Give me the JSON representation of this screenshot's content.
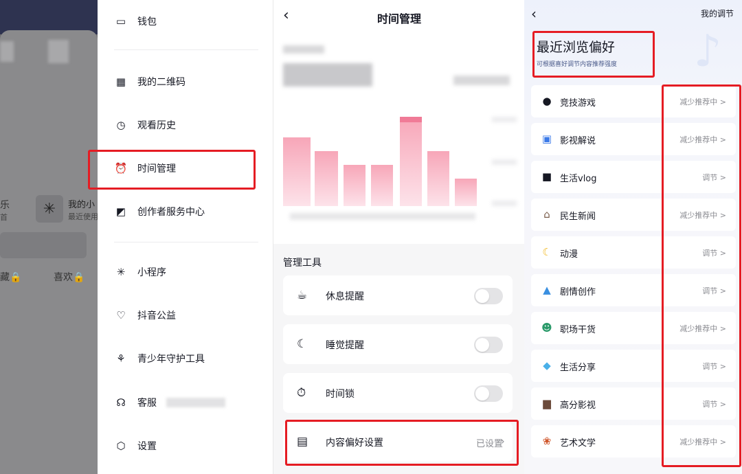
{
  "profile_panel": {
    "frag_le": "乐",
    "frag_ye": "首",
    "mine_label": "我的小",
    "recent_label": "最近使用",
    "fav_label": "藏🔒",
    "like_label": "喜欢🔒"
  },
  "menu": {
    "items": [
      {
        "label": "钱包",
        "icon": "wallet-icon"
      },
      {
        "label": "我的二维码",
        "icon": "qrcode-icon"
      },
      {
        "label": "观看历史",
        "icon": "clock-icon"
      },
      {
        "label": "时间管理",
        "icon": "alarm-icon"
      },
      {
        "label": "创作者服务中心",
        "icon": "chart-icon"
      },
      {
        "label": "小程序",
        "icon": "asterisk-icon"
      },
      {
        "label": "抖音公益",
        "icon": "heart-icon"
      },
      {
        "label": "青少年守护工具",
        "icon": "sprout-icon"
      },
      {
        "label": "客服",
        "icon": "headset-icon"
      },
      {
        "label": "设置",
        "icon": "hexagon-icon"
      }
    ]
  },
  "time_mgmt": {
    "title": "时间管理",
    "tools_header": "管理工具",
    "tools": [
      {
        "label": "休息提醒",
        "icon": "coffee-icon"
      },
      {
        "label": "睡觉提醒",
        "icon": "moon-icon"
      },
      {
        "label": "时间锁",
        "icon": "timer-lock-icon"
      }
    ],
    "pref_row": {
      "label": "内容偏好设置",
      "value": "已设置",
      "icon": "document-heart-icon"
    }
  },
  "usage_chart": {
    "colors": {
      "bar": "#f7a6b8",
      "bar_peak": "#f07b97"
    }
  },
  "adjust": {
    "title": "我的调节",
    "heading": "最近浏览偏好",
    "subheading": "可根据喜好调节内容推荐强度",
    "rows": [
      {
        "label": "竞技游戏",
        "status": "减少推荐中 >",
        "icon": "billiard-ball-icon"
      },
      {
        "label": "影视解说",
        "status": "减少推荐中 >",
        "icon": "tv-icon"
      },
      {
        "label": "生活vlog",
        "status": "调节 >",
        "icon": "video-camera-icon"
      },
      {
        "label": "民生新闻",
        "status": "减少推荐中 >",
        "icon": "building-icon"
      },
      {
        "label": "动漫",
        "status": "调节 >",
        "icon": "crescent-moon-icon"
      },
      {
        "label": "剧情创作",
        "status": "调节 >",
        "icon": "scenery-icon"
      },
      {
        "label": "职场干货",
        "status": "减少推荐中 >",
        "icon": "office-worker-icon"
      },
      {
        "label": "生活分享",
        "status": "调节 >",
        "icon": "tshirt-icon"
      },
      {
        "label": "高分影视",
        "status": "调节 >",
        "icon": "film-icon"
      },
      {
        "label": "艺术文学",
        "status": "减少推荐中 >",
        "icon": "art-icon"
      }
    ]
  },
  "highlight_color": "#e51c23"
}
